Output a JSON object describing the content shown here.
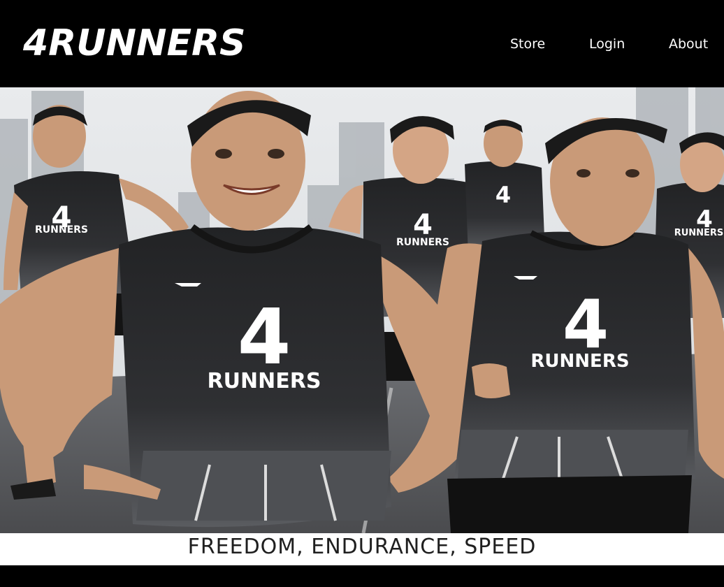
{
  "brand": {
    "name": "4RUNNERS"
  },
  "nav": [
    {
      "label": "Store"
    },
    {
      "label": "Login"
    },
    {
      "label": "About"
    }
  ],
  "hero": {
    "subject": "Group of runners wearing black 4 RUNNERS adidas tank tops running on a city road",
    "shirt_number": "4",
    "shirt_text": "RUNNERS"
  },
  "tagline": "FREEDOM, ENDURANCE, SPEED",
  "colors": {
    "header_bg": "#000000",
    "text_light": "#ffffff",
    "tagline_bg": "#ffffff",
    "tagline_text": "#1f1f1f"
  }
}
